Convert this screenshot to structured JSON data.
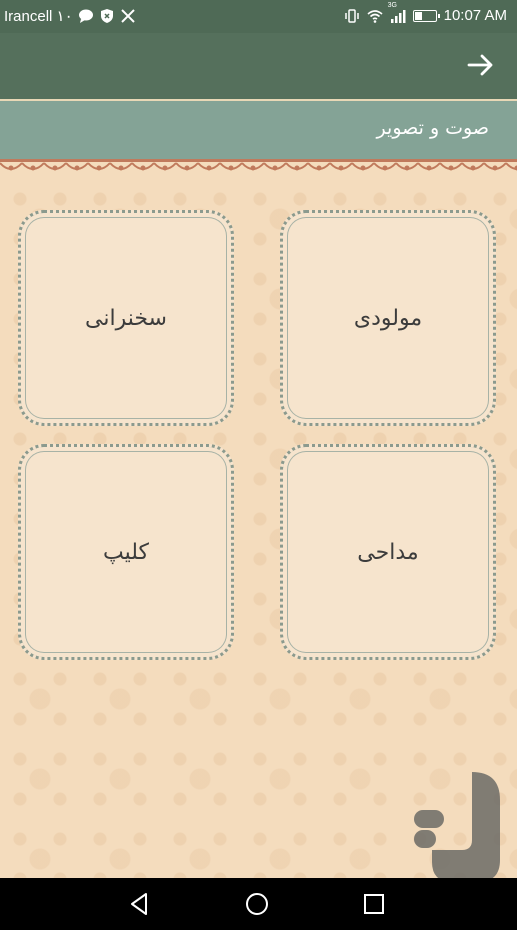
{
  "status_bar": {
    "carrier": "Irancell ۱۰",
    "time": "10:07 AM",
    "network_type": "3G",
    "battery_level": 0.35,
    "icons": [
      "chat-bubble-icon",
      "shield-icon",
      "tools-icon",
      "vibrate-icon",
      "wifi-icon",
      "signal-icon",
      "battery-icon"
    ]
  },
  "app_bar": {
    "back_icon": "arrow-right-icon"
  },
  "section": {
    "title": "صوت و تصویر"
  },
  "tiles": [
    {
      "label": "مولودی"
    },
    {
      "label": "سخنرانی"
    },
    {
      "label": "مداحی"
    },
    {
      "label": "کلیپ"
    }
  ],
  "colors": {
    "status_bar": "#4f6a56",
    "app_bar": "#55705c",
    "section_header": "#84a396",
    "background": "#f4dcbd",
    "tile_border": "#8b9a8e"
  },
  "nav_bar": {
    "icons": [
      "back-triangle-icon",
      "home-circle-icon",
      "recents-square-icon"
    ]
  }
}
